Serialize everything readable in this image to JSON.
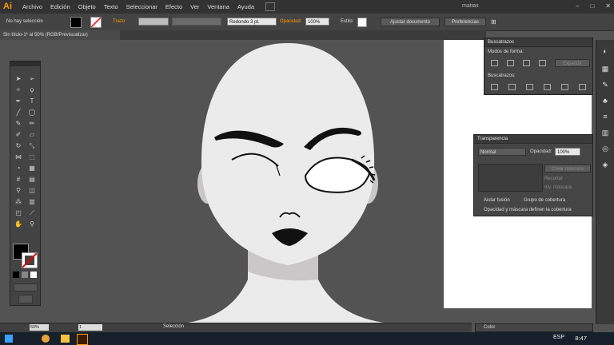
{
  "app": {
    "logo": "Ai",
    "menus": [
      "Archivo",
      "Edición",
      "Objeto",
      "Texto",
      "Seleccionar",
      "Efecto",
      "Ver",
      "Ventana",
      "Ayuda"
    ],
    "user": "matias",
    "window_buttons": [
      "–",
      "□",
      "✕"
    ]
  },
  "controlbar": {
    "selection_label": "No hay selección",
    "stroke_label": "Trazo:",
    "brush_value": "Redondo 3 pt.",
    "opacity_label": "Opacidad:",
    "opacity_value": "100%",
    "style_label": "Estilo:",
    "adjust_button": "Ajustar documento",
    "prefs_button": "Preferencias",
    "colors": {
      "stroke_label": "#ff9a00",
      "opacity_label": "#ff9a00"
    }
  },
  "document": {
    "tab_title": "Sin título-1* al 50% (RGB/Previsualizar)"
  },
  "pathfinder": {
    "title": "Buscatrazos",
    "shape_modes_label": "Modos de forma:",
    "expand_button": "Expandir",
    "pathfinders_label": "Buscatrazos:"
  },
  "transparency": {
    "title": "Transparencia",
    "blend_mode": "Normal",
    "opacity_label": "Opacidad:",
    "opacity_value": "100%",
    "make_mask_button": "Crear máscara",
    "clip_label": "Recortar",
    "invert_label": "Inv. máscara",
    "isolate_label": "Aislar fusión",
    "knockout_label": "Grupo de cobertura",
    "opacity_mask_label": "Opacidad y máscara definen la cobertura"
  },
  "statusbar": {
    "zoom": "50%",
    "page": "1",
    "mode": "Selección",
    "color_panel": "Color"
  },
  "taskbar": {
    "lang": "ESP",
    "time": "8:47"
  },
  "tools": [
    "selection-tool",
    "direct-selection-tool",
    "magic-wand-tool",
    "lasso-tool",
    "pen-tool",
    "type-tool",
    "line-tool",
    "ellipse-tool",
    "paintbrush-tool",
    "pencil-tool",
    "blob-brush-tool",
    "eraser-tool",
    "rotate-tool",
    "scale-tool",
    "width-tool",
    "free-transform-tool",
    "shape-builder-tool",
    "perspective-grid-tool",
    "mesh-tool",
    "gradient-tool",
    "eyedropper-tool",
    "blend-tool",
    "symbol-sprayer-tool",
    "column-graph-tool",
    "artboard-tool",
    "slice-tool",
    "hand-tool",
    "zoom-tool"
  ]
}
